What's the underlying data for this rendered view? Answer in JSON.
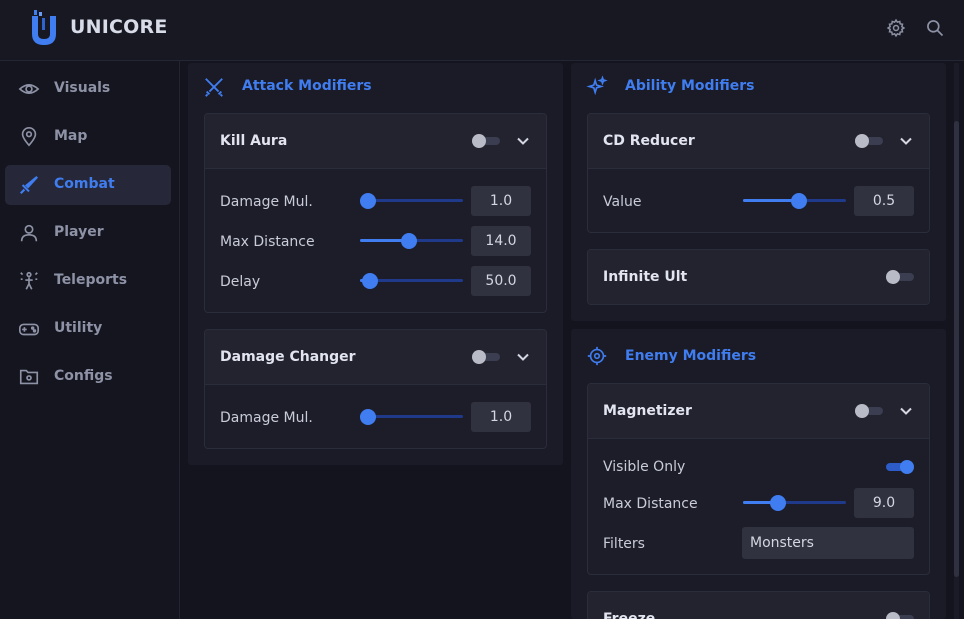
{
  "brand": {
    "name": "UNICORE"
  },
  "colors": {
    "accent": "#3f7df0",
    "background": "#13141d",
    "panel": "#1a1b26"
  },
  "header": {
    "icons": [
      "gear-icon",
      "search-icon"
    ]
  },
  "sidebar": {
    "items": [
      {
        "label": "Visuals",
        "icon": "eye-icon",
        "active": false
      },
      {
        "label": "Map",
        "icon": "map-pin-icon",
        "active": false
      },
      {
        "label": "Combat",
        "icon": "sword-icon",
        "active": true
      },
      {
        "label": "Player",
        "icon": "user-icon",
        "active": false
      },
      {
        "label": "Teleports",
        "icon": "teleport-icon",
        "active": false
      },
      {
        "label": "Utility",
        "icon": "gamepad-icon",
        "active": false
      },
      {
        "label": "Configs",
        "icon": "folder-gear-icon",
        "active": false
      }
    ]
  },
  "attack": {
    "title": "Attack Modifiers",
    "kill_aura": {
      "title": "Kill Aura",
      "enabled": false,
      "damage_mul": {
        "label": "Damage Mul.",
        "value": "1.0",
        "fraction": 0.0
      },
      "max_distance": {
        "label": "Max Distance",
        "value": "14.0",
        "fraction": 0.47
      },
      "delay": {
        "label": "Delay",
        "value": "50.0",
        "fraction": 0.02
      }
    },
    "damage_changer": {
      "title": "Damage Changer",
      "enabled": false,
      "damage_mul": {
        "label": "Damage Mul.",
        "value": "1.0",
        "fraction": 0.0
      }
    }
  },
  "ability": {
    "title": "Ability Modifiers",
    "cd_reducer": {
      "title": "CD Reducer",
      "enabled": false,
      "value": {
        "label": "Value",
        "value": "0.5",
        "fraction": 0.55
      }
    },
    "infinite_ult": {
      "title": "Infinite Ult",
      "enabled": false
    }
  },
  "enemy": {
    "title": "Enemy Modifiers",
    "magnetizer": {
      "title": "Magnetizer",
      "enabled": false,
      "visible_only": {
        "label": "Visible Only",
        "enabled": true
      },
      "max_distance": {
        "label": "Max Distance",
        "value": "9.0",
        "fraction": 0.31
      },
      "filters": {
        "label": "Filters",
        "value": "Monsters"
      }
    },
    "freeze": {
      "title": "Freeze",
      "enabled": false
    }
  }
}
